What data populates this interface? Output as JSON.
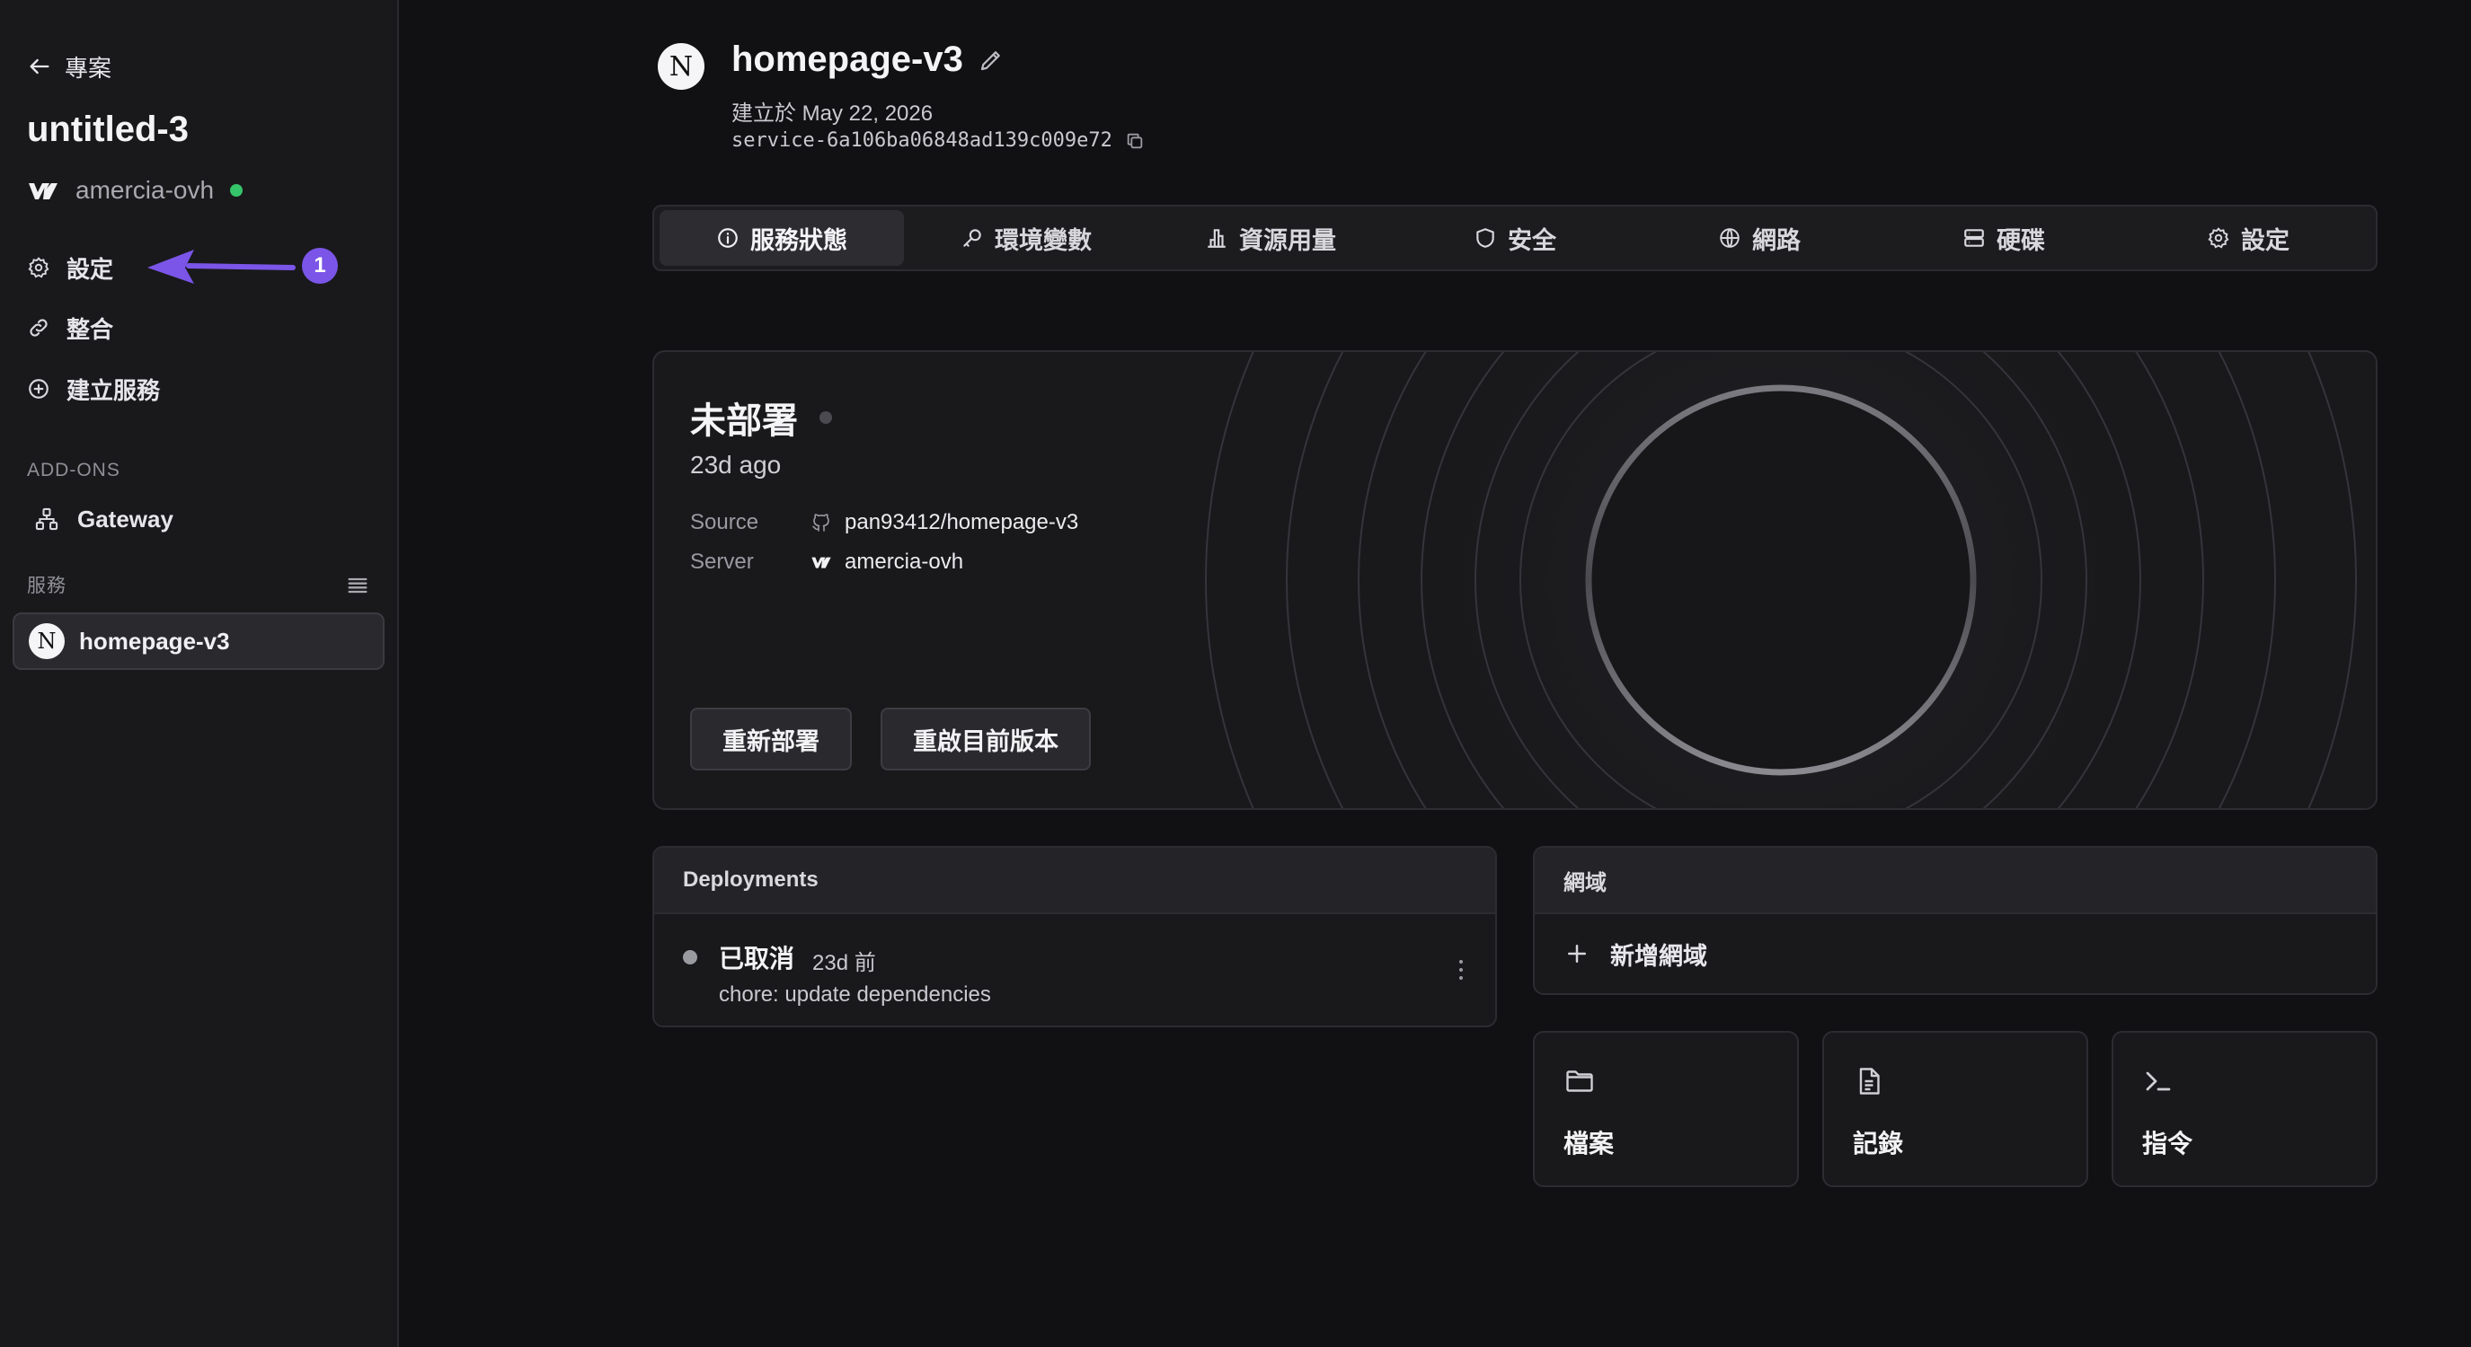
{
  "sidebar": {
    "back_label": "專案",
    "project_title": "untitled-3",
    "server_name": "amercia-ovh",
    "nav": {
      "settings": "設定",
      "integrations": "整合",
      "create_service": "建立服務"
    },
    "addons_label": "ADD-ONS",
    "gateway_label": "Gateway",
    "services_label": "服務",
    "services": [
      {
        "name": "homepage-v3",
        "logo": "N"
      }
    ]
  },
  "annotation": {
    "badge": "1",
    "color": "#7b55e8"
  },
  "header": {
    "logo": "N",
    "service_name": "homepage-v3",
    "created": "建立於 May 22, 2026",
    "service_id": "service-6a106ba06848ad139c009e72"
  },
  "tabs": [
    {
      "label": "服務狀態",
      "icon": "info-icon",
      "active": true
    },
    {
      "label": "環境變數",
      "icon": "key-icon"
    },
    {
      "label": "資源用量",
      "icon": "bar-chart-icon"
    },
    {
      "label": "安全",
      "icon": "shield-icon"
    },
    {
      "label": "網路",
      "icon": "globe-icon"
    },
    {
      "label": "硬碟",
      "icon": "disk-icon"
    },
    {
      "label": "設定",
      "icon": "gear-icon"
    }
  ],
  "status": {
    "title": "未部署",
    "ago": "23d ago",
    "source_label": "Source",
    "source_value": "pan93412/homepage-v3",
    "server_label": "Server",
    "server_value": "amercia-ovh",
    "redeploy": "重新部署",
    "restart": "重啟目前版本"
  },
  "deployments": {
    "title": "Deployments",
    "items": [
      {
        "status": "已取消",
        "time": "23d 前",
        "message": "chore: update dependencies"
      }
    ]
  },
  "domains": {
    "title": "網域",
    "add_label": "新增網域"
  },
  "tiles": {
    "files": "檔案",
    "logs": "記錄",
    "commands": "指令"
  },
  "colors": {
    "accent": "#7b55e8",
    "online": "#36c46b",
    "background": "#111113",
    "sidebar": "#19191c"
  }
}
